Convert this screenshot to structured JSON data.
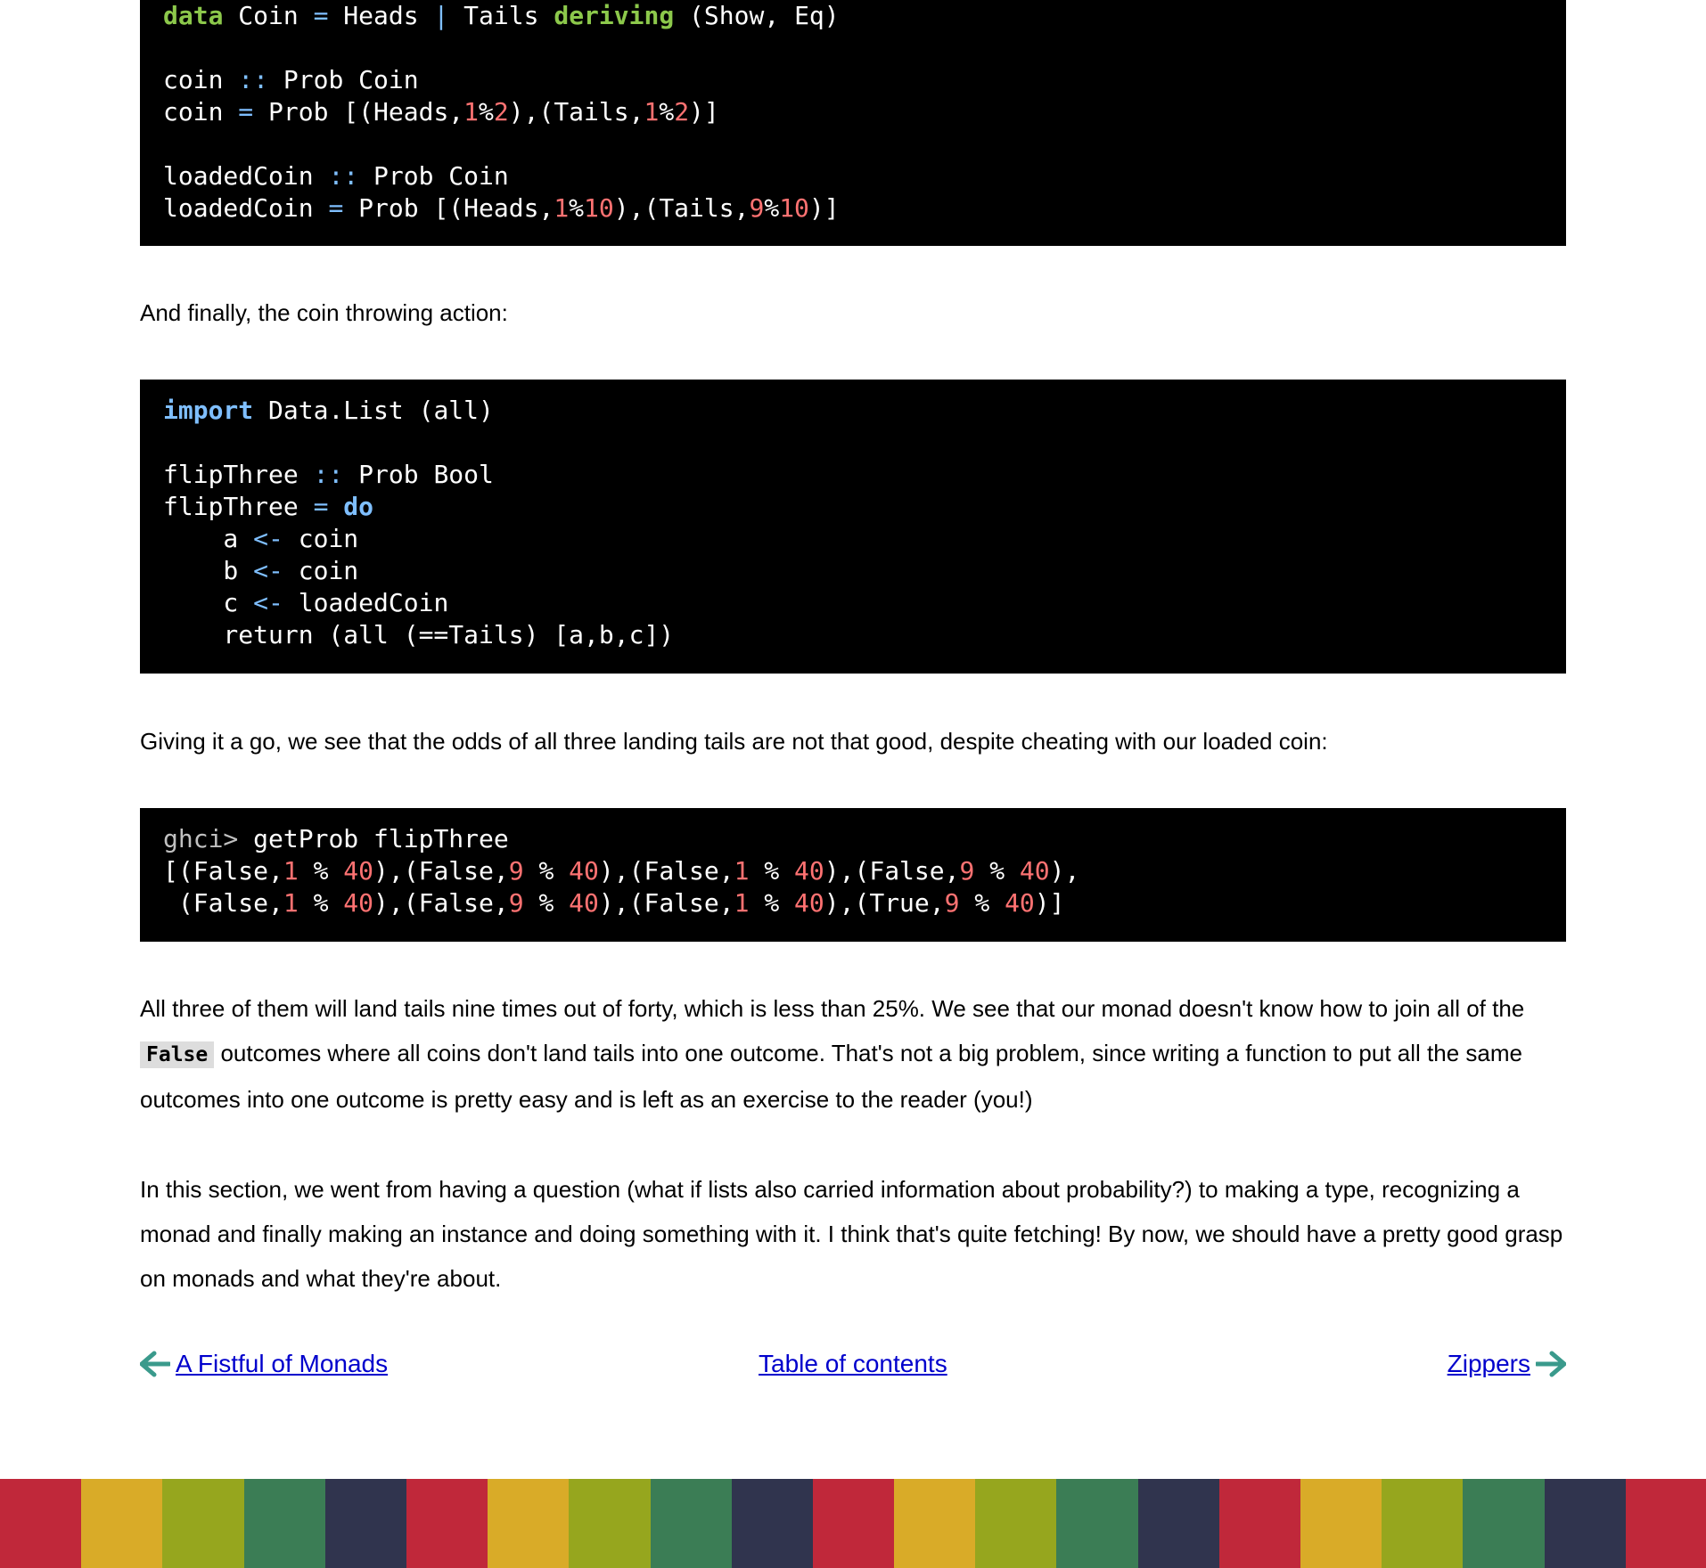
{
  "code_block_1": {
    "lines": [
      [
        {
          "t": "data",
          "c": "kw"
        },
        {
          "t": " Coin "
        },
        {
          "t": "=",
          "c": "op"
        },
        {
          "t": " Heads "
        },
        {
          "t": "|",
          "c": "op"
        },
        {
          "t": " Tails "
        },
        {
          "t": "deriving",
          "c": "kw"
        },
        {
          "t": " (Show, Eq)"
        }
      ],
      [],
      [
        {
          "t": "coin "
        },
        {
          "t": "::",
          "c": "op"
        },
        {
          "t": " Prob Coin"
        }
      ],
      [
        {
          "t": "coin "
        },
        {
          "t": "=",
          "c": "op"
        },
        {
          "t": " Prob [(Heads,"
        },
        {
          "t": "1",
          "c": "num"
        },
        {
          "t": "%"
        },
        {
          "t": "2",
          "c": "num"
        },
        {
          "t": "),(Tails,"
        },
        {
          "t": "1",
          "c": "num"
        },
        {
          "t": "%"
        },
        {
          "t": "2",
          "c": "num"
        },
        {
          "t": ")]"
        }
      ],
      [],
      [
        {
          "t": "loadedCoin "
        },
        {
          "t": "::",
          "c": "op"
        },
        {
          "t": " Prob Coin"
        }
      ],
      [
        {
          "t": "loadedCoin "
        },
        {
          "t": "=",
          "c": "op"
        },
        {
          "t": " Prob [(Heads,"
        },
        {
          "t": "1",
          "c": "num"
        },
        {
          "t": "%"
        },
        {
          "t": "10",
          "c": "num"
        },
        {
          "t": "),(Tails,"
        },
        {
          "t": "9",
          "c": "num"
        },
        {
          "t": "%"
        },
        {
          "t": "10",
          "c": "num"
        },
        {
          "t": ")]"
        }
      ]
    ]
  },
  "para_1": "And finally, the coin throwing action:",
  "code_block_2": {
    "lines": [
      [
        {
          "t": "import",
          "c": "kwb"
        },
        {
          "t": " Data.List (all)"
        }
      ],
      [],
      [
        {
          "t": "flipThree "
        },
        {
          "t": "::",
          "c": "op"
        },
        {
          "t": " Prob Bool"
        }
      ],
      [
        {
          "t": "flipThree "
        },
        {
          "t": "=",
          "c": "op"
        },
        {
          "t": " "
        },
        {
          "t": "do",
          "c": "kwb"
        }
      ],
      [
        {
          "t": "    a "
        },
        {
          "t": "<-",
          "c": "op"
        },
        {
          "t": " coin"
        }
      ],
      [
        {
          "t": "    b "
        },
        {
          "t": "<-",
          "c": "op"
        },
        {
          "t": " coin"
        }
      ],
      [
        {
          "t": "    c "
        },
        {
          "t": "<-",
          "c": "op"
        },
        {
          "t": " loadedCoin"
        }
      ],
      [
        {
          "t": "    return (all (==Tails) [a,b,c])"
        }
      ]
    ]
  },
  "para_2": "Giving it a go, we see that the odds of all three landing tails are not that good, despite cheating with our loaded coin:",
  "code_block_3": {
    "lines": [
      [
        {
          "t": "ghci>",
          "c": "prompt"
        },
        {
          "t": " getProb flipThree"
        }
      ],
      [
        {
          "t": "[(False,"
        },
        {
          "t": "1",
          "c": "num"
        },
        {
          "t": " % "
        },
        {
          "t": "40",
          "c": "num"
        },
        {
          "t": "),(False,"
        },
        {
          "t": "9",
          "c": "num"
        },
        {
          "t": " % "
        },
        {
          "t": "40",
          "c": "num"
        },
        {
          "t": "),(False,"
        },
        {
          "t": "1",
          "c": "num"
        },
        {
          "t": " % "
        },
        {
          "t": "40",
          "c": "num"
        },
        {
          "t": "),(False,"
        },
        {
          "t": "9",
          "c": "num"
        },
        {
          "t": " % "
        },
        {
          "t": "40",
          "c": "num"
        },
        {
          "t": "),"
        }
      ],
      [
        {
          "t": " (False,"
        },
        {
          "t": "1",
          "c": "num"
        },
        {
          "t": " % "
        },
        {
          "t": "40",
          "c": "num"
        },
        {
          "t": "),(False,"
        },
        {
          "t": "9",
          "c": "num"
        },
        {
          "t": " % "
        },
        {
          "t": "40",
          "c": "num"
        },
        {
          "t": "),(False,"
        },
        {
          "t": "1",
          "c": "num"
        },
        {
          "t": " % "
        },
        {
          "t": "40",
          "c": "num"
        },
        {
          "t": "),(True,"
        },
        {
          "t": "9",
          "c": "num"
        },
        {
          "t": " % "
        },
        {
          "t": "40",
          "c": "num"
        },
        {
          "t": ")]"
        }
      ]
    ]
  },
  "para_3": {
    "before": "All three of them will land tails nine times out of forty, which is less than 25%. We see that our monad doesn't know how to join all of the ",
    "code": "False",
    "after": " outcomes where all coins don't land tails into one outcome. That's not a big problem, since writing a function to put all the same outcomes into one outcome is pretty easy and is left as an exercise to the reader (you!)"
  },
  "para_4": "In this section, we went from having a question (what if lists also carried information about probability?) to making a type, recognizing a monad and finally making an instance and doing something with it. I think that's quite fetching! By now, we should have a pretty good grasp on monads and what they're about.",
  "nav": {
    "prev_label": "A Fistful of Monads",
    "toc_label": "Table of contents",
    "next_label": "Zippers",
    "arrow_color": "#3a9a8c",
    "link_color": "#0000cc"
  },
  "footer": {
    "stripe_colors": [
      "#c0283a",
      "#d9ab28",
      "#96a61e",
      "#3b7d55",
      "#30344e",
      "#c0283a",
      "#d9ab28",
      "#96a61e",
      "#3b7d55",
      "#30344e",
      "#c0283a",
      "#d9ab28",
      "#96a61e",
      "#3b7d55",
      "#30344e",
      "#c0283a",
      "#d9ab28",
      "#96a61e",
      "#3b7d55",
      "#30344e",
      "#c0283a"
    ]
  }
}
